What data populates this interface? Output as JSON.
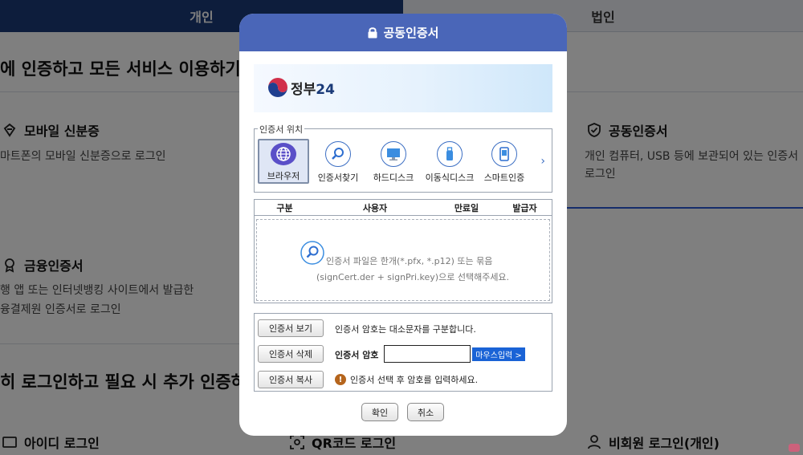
{
  "background": {
    "tabs": [
      {
        "label": "개인"
      },
      {
        "label": "법인"
      }
    ],
    "heading1": "에 인증하고 모든 서비스 이용하기",
    "heading2": "히 로그인하고 필요 시 추가 인증하기",
    "options": {
      "mobile_id": {
        "title": "모바일 신분증",
        "desc": "마트폰의 모바일 신분증으로 로그인"
      },
      "joint_cert": {
        "title": "공동인증서",
        "desc1": "개인 컴퓨터, USB 등에 보관되어 있는 인증서",
        "desc2": "로그인"
      },
      "financial_cert": {
        "title": "금융인증서",
        "desc1": "행 앱 또는 인터넷뱅킹 사이트에서 발급한",
        "desc2": "융결제원 인증서로 로그인"
      },
      "id_login": {
        "title": "아이디 로그인"
      },
      "qr_login": {
        "title": "QR코드 로그인"
      },
      "guest_login": {
        "title": "비회원 로그인(개인)"
      }
    }
  },
  "modal": {
    "title": "공동인증서",
    "banner": {
      "logo_text": "정부",
      "logo_num": "24"
    },
    "location_legend": "인증서 위치",
    "locations": [
      {
        "label": "브라우저",
        "icon": "globe-icon",
        "selected": true
      },
      {
        "label": "인증서찾기",
        "icon": "search-icon",
        "selected": false
      },
      {
        "label": "하드디스크",
        "icon": "monitor-icon",
        "selected": false
      },
      {
        "label": "이동식디스크",
        "icon": "usb-icon",
        "selected": false
      },
      {
        "label": "스마트인증",
        "icon": "phone-icon",
        "selected": false
      }
    ],
    "table": {
      "columns": [
        "구분",
        "사용자",
        "만료일",
        "발급자"
      ],
      "drop_line1": "인증서 파일은 한개(*.pfx, *.p12) 또는 묶음",
      "drop_line2": "(signCert.der + signPri.key)으로 선택해주세요."
    },
    "buttons": {
      "view": "인증서 보기",
      "delete": "인증서 삭제",
      "copy": "인증서 복사",
      "mouse_input": "마우스입력 >",
      "confirm": "확인",
      "cancel": "취소"
    },
    "password": {
      "note": "인증서 암호는 대소문자를 구분합니다.",
      "label": "인증서 암호",
      "value": "",
      "warning": "인증서 선택 후 암호를 입력하세요."
    }
  },
  "colors": {
    "header": "#4a66b8",
    "tab_active": "#1a3a78",
    "mouse_button": "#1a63d6",
    "warning": "#b5651d"
  }
}
